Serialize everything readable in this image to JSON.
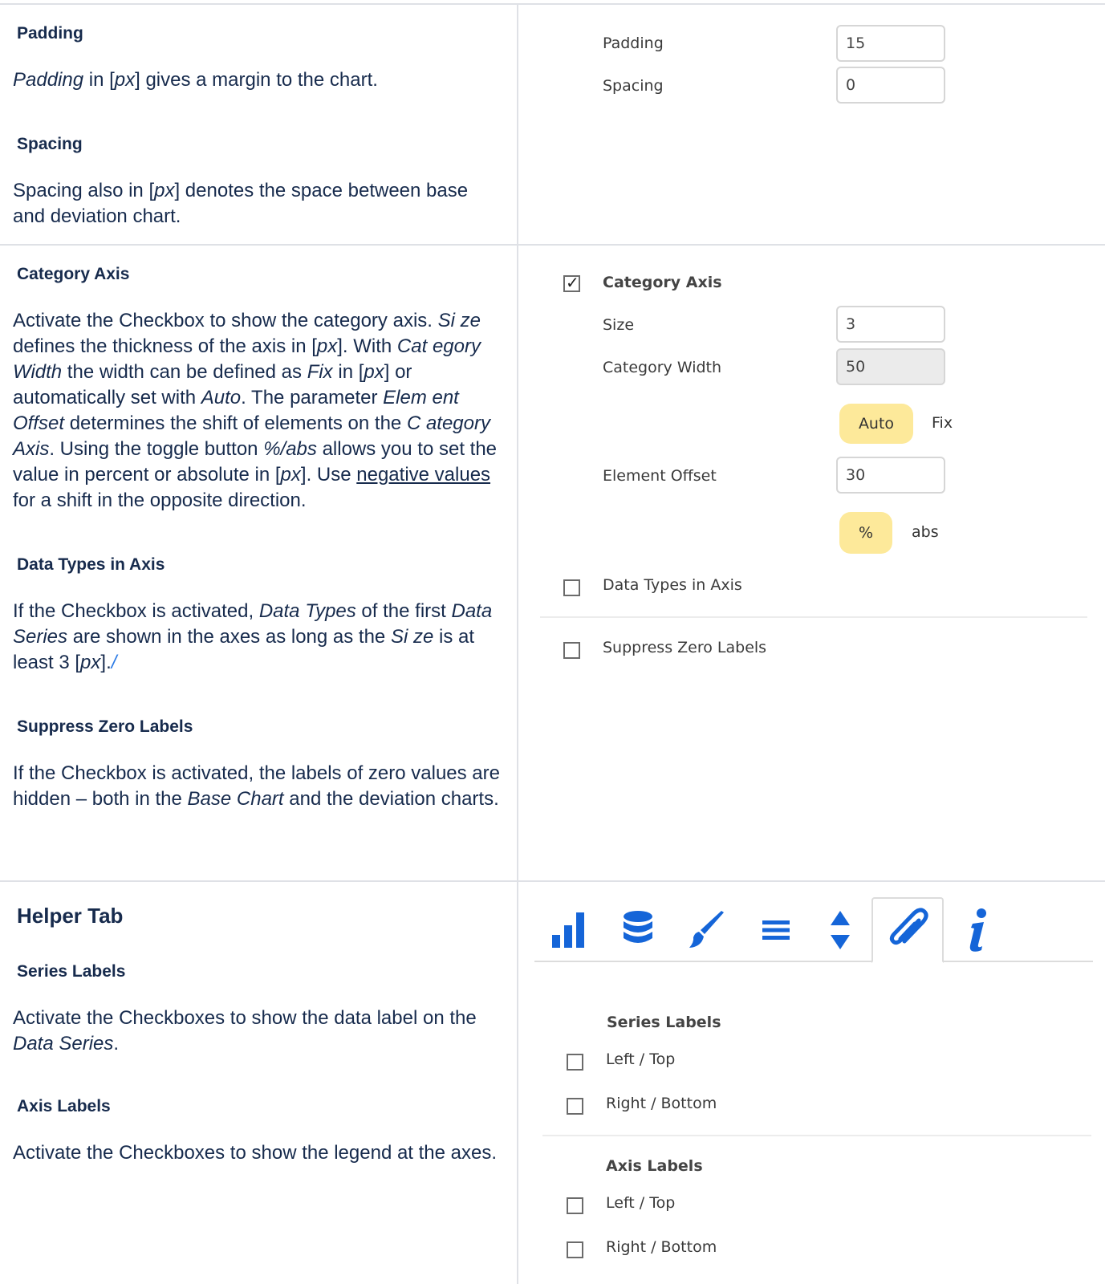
{
  "section1": {
    "padding_heading": "Padding",
    "padding_text_em": "Padding",
    "padding_text_1": " in [",
    "padding_text_px": "px",
    "padding_text_2": "] gives a margin to the chart.",
    "spacing_heading": "Spacing",
    "spacing_text_1": "Spacing also in [",
    "spacing_text_px": "px",
    "spacing_text_2": "] denotes the space between base and deviation chart.",
    "ui": {
      "padding_label": "Padding",
      "padding_value": "15",
      "spacing_label": "Spacing",
      "spacing_value": "0"
    }
  },
  "section2": {
    "category_heading": "Category Axis",
    "category_text": {
      "t1": "Activate the Checkbox to show the category axis. ",
      "e1": "Si ze",
      "t2": " defines the thickness of the axis in [",
      "px1": "px",
      "t3": "]. With ",
      "e2": "Cat egory Width",
      "t4": " the width can be defined as ",
      "e3": "Fix",
      "t5": " in [",
      "px2": "px",
      "t6": "] or automatically set with ",
      "e4": "Auto",
      "t7": ". The parameter ",
      "e5": "Elem ent Offset",
      "t8": " determines the shift of elements on the ",
      "e6": "C ategory Axis",
      "t9": ". Using the toggle button ",
      "e7": "%/abs",
      "t10": " allows you to set the value in percent or absolute in [",
      "px3": "px",
      "t11": "]. Use ",
      "u1": "negative values",
      "t12": " for a shift in the opposite direction."
    },
    "datatypes_heading": "Data Types in Axis",
    "datatypes_text": {
      "t1": "If the Checkbox is activated, ",
      "e1": "Data Types",
      "t2": " of the first ",
      "e2": "Data Series",
      "t3": " are shown in the axes as long as the ",
      "e3": "Si ze",
      "t4": " is at least 3 [",
      "px": "px",
      "t5": "].",
      "link": "/"
    },
    "suppress_heading": "Suppress Zero Labels",
    "suppress_text": {
      "t1": "If the Checkbox is activated, the labels of zero values are hidden – both in the ",
      "e1": "Base Chart",
      "t2": " and the deviation charts."
    },
    "ui": {
      "category_axis_label": "Category Axis",
      "category_axis_checked": true,
      "size_label": "Size",
      "size_value": "3",
      "category_width_label": "Category Width",
      "category_width_value": "50",
      "auto_label": "Auto",
      "fix_label": "Fix",
      "element_offset_label": "Element Offset",
      "element_offset_value": "30",
      "percent_label": "%",
      "abs_label": "abs",
      "data_types_label": "Data Types in Axis",
      "suppress_zero_label": "Suppress Zero Labels"
    }
  },
  "section3": {
    "helper_heading": "Helper Tab",
    "series_heading": "Series Labels",
    "series_text_1": "Activate the Checkboxes to show the data label on the ",
    "series_text_em": "Data Series",
    "series_text_2": ".",
    "axis_heading": "Axis Labels",
    "axis_text": "Activate the Checkboxes to show the legend at the axes.",
    "ui": {
      "tabs": [
        "bar-chart-icon",
        "database-icon",
        "brush-icon",
        "list-icon",
        "sort-icon",
        "paperclip-icon",
        "info-icon"
      ],
      "active_tab": "paperclip-icon",
      "icon_color": "#1565d8",
      "series_labels_title": "Series Labels",
      "series_left_top": "Left / Top",
      "series_right_bottom": "Right / Bottom",
      "axis_labels_title": "Axis Labels",
      "axis_left_top": "Left / Top",
      "axis_right_bottom": "Right / Bottom"
    }
  }
}
